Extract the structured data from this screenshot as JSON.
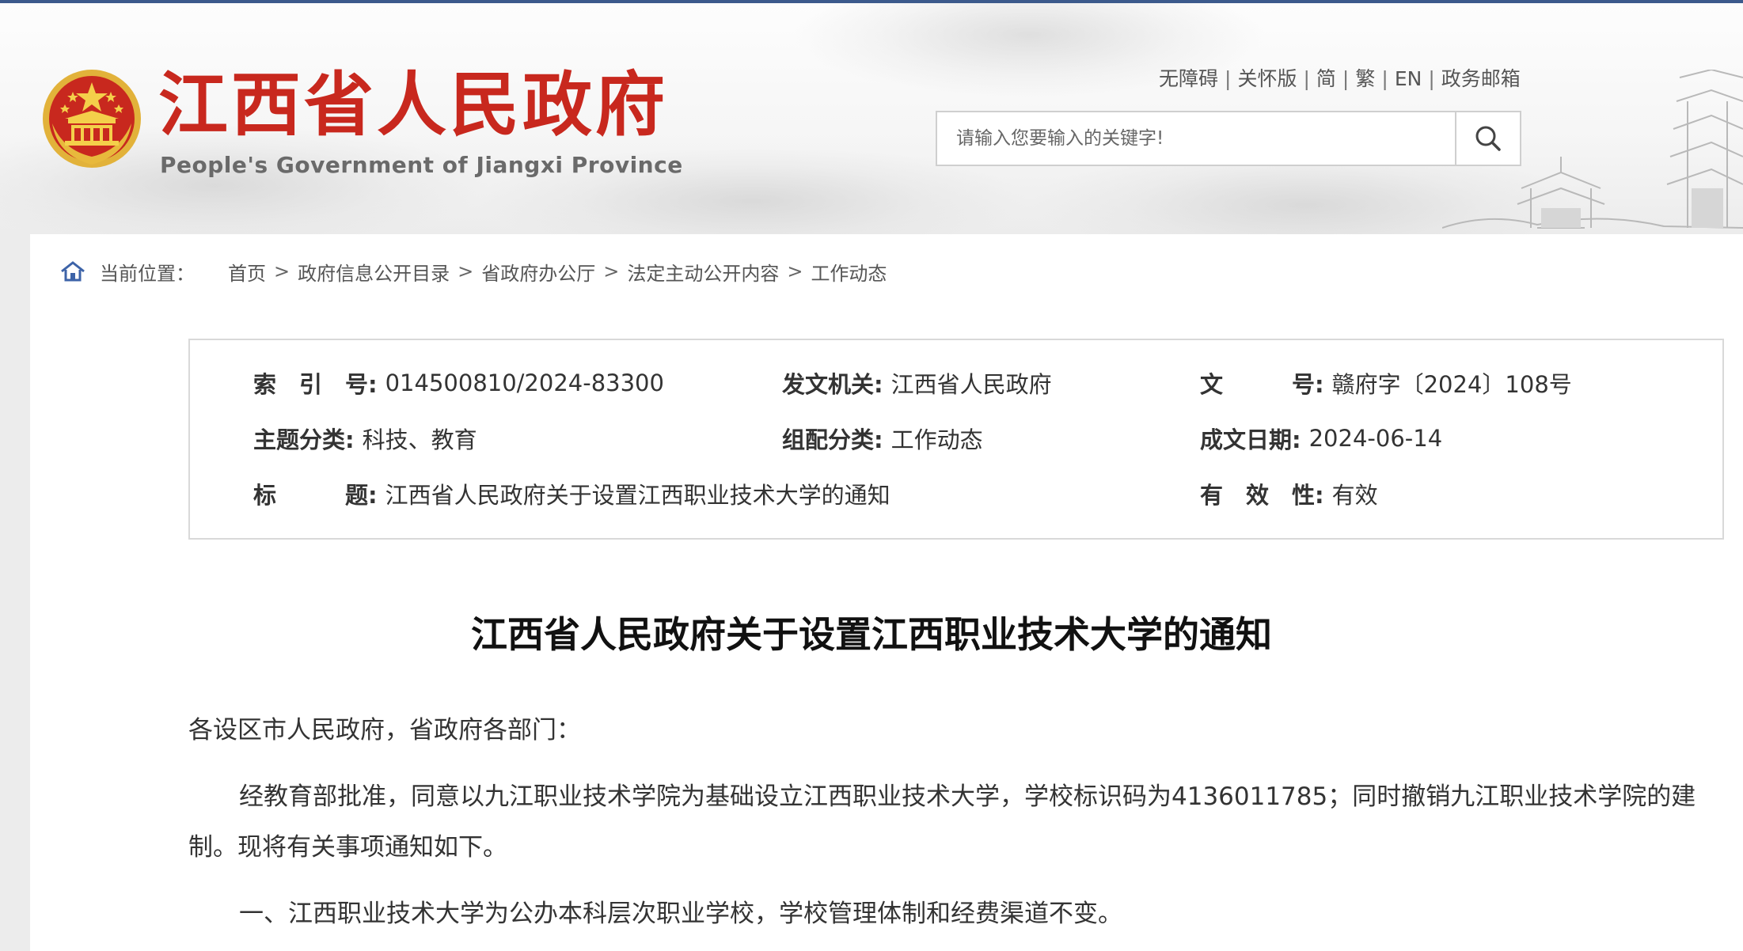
{
  "header": {
    "logo_cn": "江西省人民政府",
    "logo_en": "People's Government of Jiangxi Province",
    "links": [
      "无障碍",
      "关怀版",
      "简",
      "繁",
      "EN",
      "政务邮箱"
    ],
    "search_placeholder": "请输入您要输入的关键字!"
  },
  "breadcrumb": {
    "label": "当前位置：",
    "items": [
      "首页",
      "政府信息公开目录",
      "省政府办公厅",
      "法定主动公开内容",
      "工作动态"
    ],
    "separator": ">"
  },
  "meta": {
    "index_label": "索　引　号:",
    "index_value": "014500810/2024-83300",
    "issuer_label": "发文机关:",
    "issuer_value": "江西省人民政府",
    "docno_label": "文　　　号:",
    "docno_value": "赣府字〔2024〕108号",
    "topic_label": "主题分类:",
    "topic_value": "科技、教育",
    "group_label": "组配分类:",
    "group_value": "工作动态",
    "date_label": "成文日期:",
    "date_value": "2024-06-14",
    "title_label": "标　　　题:",
    "title_value": "江西省人民政府关于设置江西职业技术大学的通知",
    "valid_label": "有　效　性:",
    "valid_value": "有效"
  },
  "article": {
    "title": "江西省人民政府关于设置江西职业技术大学的通知",
    "salutation": "各设区市人民政府，省政府各部门：",
    "para1_line1": "经教育部批准，同意以九江职业技术学院为基础设立江西职业技术大学，学校标识码为4136011785；同时撤销九江职业技术学院的建",
    "para1_line2": "制。现将有关事项通知如下。",
    "para2": "一、江西职业技术大学为公办本科层次职业学校，学校管理体制和经费渠道不变。"
  },
  "colors": {
    "logo_red": "#c8281e",
    "top_line": "#3c5a8c",
    "home_icon": "#3d63a8"
  }
}
